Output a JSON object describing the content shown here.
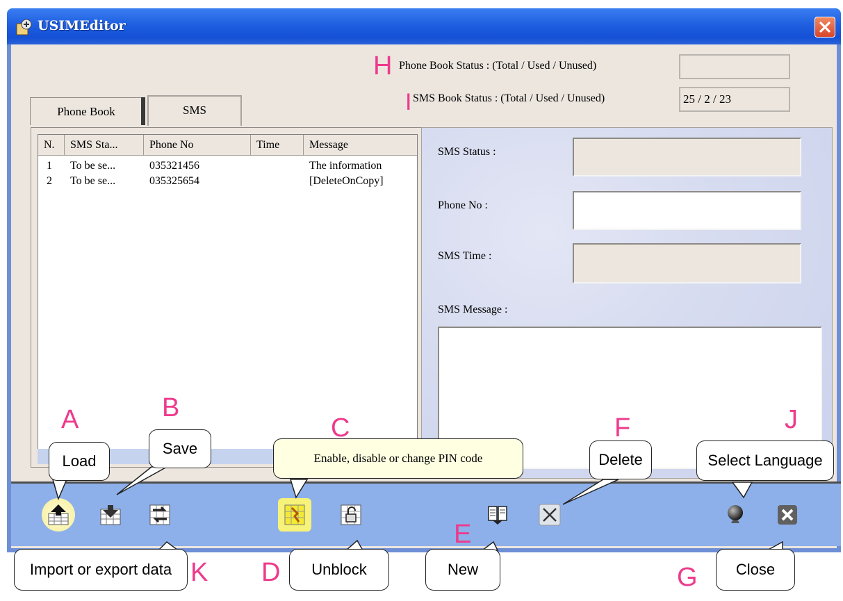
{
  "window": {
    "title": "USIMEditor"
  },
  "status": {
    "phone_book_label": "Phone Book Status : (Total / Used / Unused)",
    "phone_book_value": "",
    "sms_book_label": "SMS Book Status : (Total / Used / Unused)",
    "sms_book_value": "25 / 2 / 23"
  },
  "tabs": [
    {
      "label": "Phone Book"
    },
    {
      "label": "SMS"
    }
  ],
  "sms_list": {
    "columns": [
      "N.",
      "SMS Sta...",
      "Phone No",
      "Time",
      "Message"
    ],
    "rows": [
      [
        "1",
        "To be se...",
        "035321456",
        "",
        "The information"
      ],
      [
        "2",
        "To be se...",
        "035325654",
        "",
        "[DeleteOnCopy]"
      ]
    ]
  },
  "detail": {
    "sms_status_label": "SMS Status :",
    "phone_no_label": "Phone No :",
    "sms_time_label": "SMS Time :",
    "sms_message_label": "SMS Message :"
  },
  "annotations": {
    "letters": [
      "A",
      "B",
      "C",
      "D",
      "E",
      "F",
      "G",
      "H",
      "I",
      "J",
      "K"
    ],
    "callouts": {
      "load": "Load",
      "save": "Save",
      "pin": "Enable, disable or change PIN code",
      "delete": "Delete",
      "select_language": "Select Language",
      "import_export": "Import or export data",
      "unblock": "Unblock",
      "new": "New",
      "close": "Close"
    }
  },
  "icons": {
    "load": "load-icon",
    "save": "save-icon",
    "import_export": "import-export-icon",
    "pin": "pin-code-icon",
    "unblock": "unblock-icon",
    "new": "new-icon",
    "delete": "delete-icon",
    "language": "globe-icon",
    "close": "close-icon"
  },
  "colors": {
    "accent": "#ee3a8c",
    "titlebar": "#1f5fe0",
    "toolbar": "#8db0ea",
    "highlight": "#f6f27a"
  }
}
